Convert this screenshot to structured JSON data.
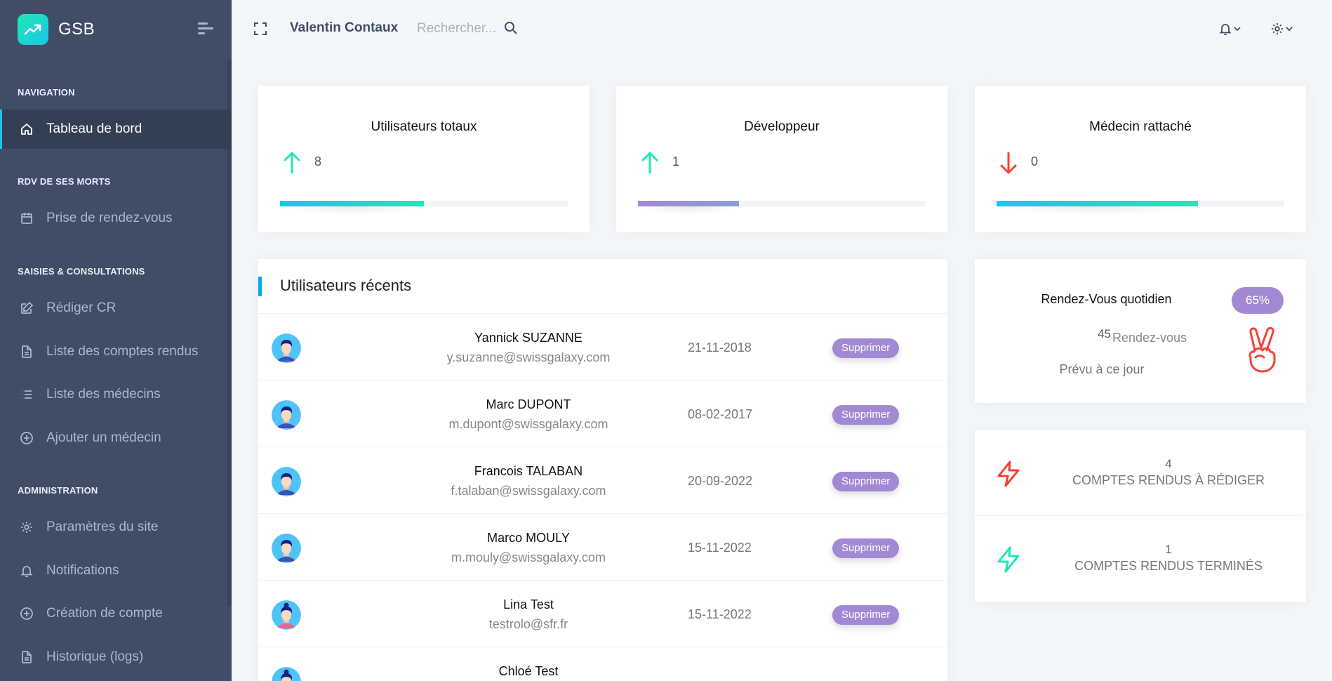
{
  "brand": {
    "name": "GSB"
  },
  "sidebar": {
    "sections": [
      {
        "caption": "NAVIGATION",
        "items": [
          {
            "label": "Tableau de bord",
            "icon": "home-icon",
            "active": true
          }
        ]
      },
      {
        "caption": "RDV DE SES MORTS",
        "items": [
          {
            "label": "Prise de rendez-vous",
            "icon": "calendar-icon"
          }
        ]
      },
      {
        "caption": "SAISIES & CONSULTATIONS",
        "items": [
          {
            "label": "Rédiger CR",
            "icon": "edit-icon"
          },
          {
            "label": "Liste des comptes rendus",
            "icon": "file-icon"
          },
          {
            "label": "Liste des médecins",
            "icon": "list-icon"
          },
          {
            "label": "Ajouter un médecin",
            "icon": "plus-circle-icon"
          }
        ]
      },
      {
        "caption": "ADMINISTRATION",
        "items": [
          {
            "label": "Paramètres du site",
            "icon": "gear-icon"
          },
          {
            "label": "Notifications",
            "icon": "bell-icon"
          },
          {
            "label": "Création de compte",
            "icon": "plus-circle-icon"
          },
          {
            "label": "Historique (logs)",
            "icon": "file-icon"
          }
        ]
      }
    ]
  },
  "header": {
    "user_name": "Valentin Contaux",
    "search_placeholder": "Rechercher..."
  },
  "stats": [
    {
      "title": "Utilisateurs totaux",
      "value": "8",
      "trend": "up",
      "progress": 0.5,
      "color_from": "#1dc4e9",
      "color_to": "#1de9b6"
    },
    {
      "title": "Développeur",
      "value": "1",
      "trend": "up",
      "progress": 0.35,
      "color_from": "#a389d4",
      "color_to": "#899ed4"
    },
    {
      "title": "Médecin rattaché",
      "value": "0",
      "trend": "down",
      "progress": 0.7,
      "color_from": "#1dc4e9",
      "color_to": "#1de9b6"
    }
  ],
  "recent": {
    "title": "Utilisateurs récents",
    "delete_label": "Supprimer",
    "users": [
      {
        "name": "Yannick SUZANNE",
        "email": "y.suzanne@swissgalaxy.com",
        "date": "21-11-2018",
        "gender": "male"
      },
      {
        "name": "Marc DUPONT",
        "email": "m.dupont@swissgalaxy.com",
        "date": "08-02-2017",
        "gender": "male"
      },
      {
        "name": "Francois TALABAN",
        "email": "f.talaban@swissgalaxy.com",
        "date": "20-09-2022",
        "gender": "male"
      },
      {
        "name": "Marco MOULY",
        "email": "m.mouly@swissgalaxy.com",
        "date": "15-11-2022",
        "gender": "male"
      },
      {
        "name": "Lina Test",
        "email": "testrolo@sfr.fr",
        "date": "15-11-2022",
        "gender": "female"
      },
      {
        "name": "Chloé Test",
        "email": "",
        "date": "",
        "gender": "female"
      }
    ]
  },
  "rdv": {
    "title": "Rendez-Vous quotidien",
    "badge": "65%",
    "count": "45",
    "unit": "Rendez-vous",
    "subtitle": "Prévu à ce jour"
  },
  "comptes": [
    {
      "count": "4",
      "label": "COMPTES RENDUS À RÉDIGER",
      "color": "#f44236"
    },
    {
      "count": "1",
      "label": "COMPTES RENDUS TERMINÉS",
      "color": "#1de9b6"
    }
  ]
}
